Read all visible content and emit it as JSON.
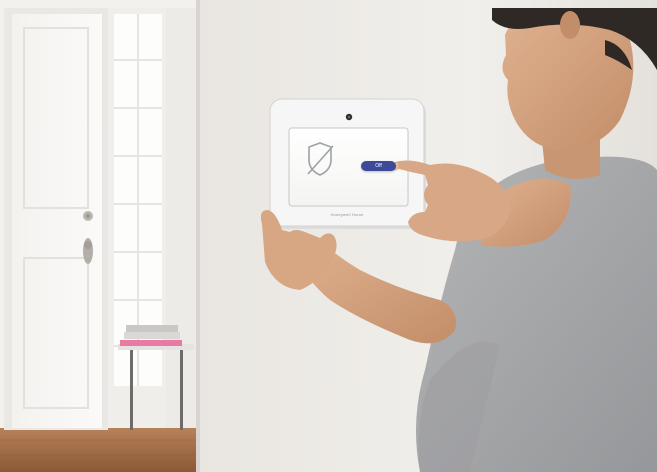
{
  "scene": {
    "panel_brand": "Honeywell Home",
    "screen_button_label": "Off",
    "screen_status_text": "",
    "palette": {
      "wall": "#eeebe6",
      "door": "#f7f6f3",
      "floor": "#9b6a45",
      "shirt": "#a8a9ab",
      "skin": "#d4a27e",
      "hair": "#2e2925",
      "panel_frame": "#f4f4f4",
      "panel_screen": "#fbfbfb",
      "accent": "#3d4a9a"
    },
    "icons": [
      "shield-slash-icon",
      "camera-lens-icon",
      "door-knob-icon",
      "deadbolt-icon"
    ]
  }
}
